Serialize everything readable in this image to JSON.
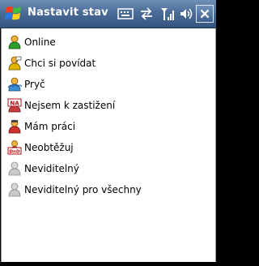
{
  "window": {
    "title": "Nastavit stav"
  },
  "statuses": [
    {
      "label": "Online",
      "icon": "online-icon"
    },
    {
      "label": "Chci si povídat",
      "icon": "chat-icon"
    },
    {
      "label": "Pryč",
      "icon": "away-icon"
    },
    {
      "label": "Nejsem k zastižení",
      "icon": "na-icon"
    },
    {
      "label": "Mám práci",
      "icon": "busy-icon"
    },
    {
      "label": "Neobtěžuj",
      "icon": "dnd-icon"
    },
    {
      "label": "Neviditelný",
      "icon": "invisible-icon"
    },
    {
      "label": "Neviditelný pro všechny",
      "icon": "invisible-all-icon"
    }
  ],
  "colors": {
    "titlebar": "#4a6c97",
    "panel": "#ffffff"
  }
}
